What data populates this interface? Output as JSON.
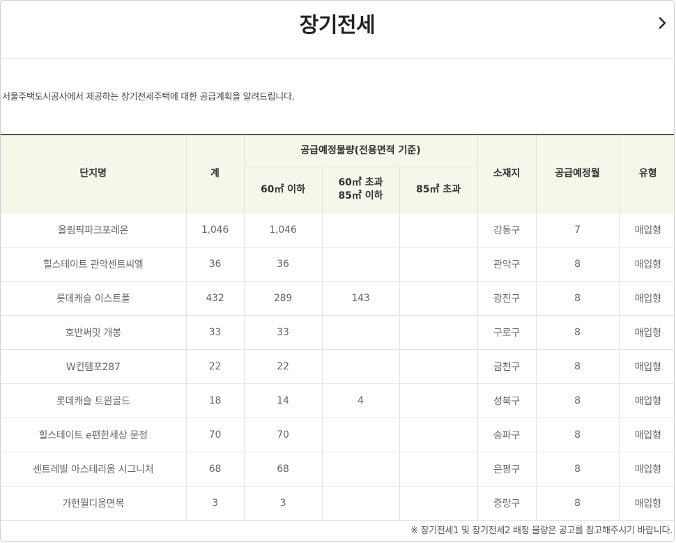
{
  "page": {
    "title": "장기전세",
    "next_icon": "chevron-right-icon",
    "intro": "서울주택도시공사에서 제공하는 장기전세주택에 대한 공급계획을 알려드립니다.",
    "footnote": "※ 장기전세1 및 장기전세2 배정 물량은 공고를 참고해주시기 바랍니다."
  },
  "colors": {
    "header_bg": "#f5f7ea",
    "table_top_border": "#555555",
    "cell_border": "#e2e2e2",
    "cell_text": "#666666"
  },
  "table": {
    "headers": {
      "name": "단지명",
      "total": "계",
      "planned_volume": "공급예정물량(전용면적 기준)",
      "size_small": "60㎡ 이하",
      "size_mid_line1": "60㎡ 초과",
      "size_mid_line2": "85㎡ 이하",
      "size_large": "85㎡ 초과",
      "location": "소재지",
      "month": "공급예정월",
      "type": "유형"
    },
    "rows": [
      {
        "name": "올림픽파크포레온",
        "total": "1,046",
        "small": "1,046",
        "mid": "",
        "large": "",
        "location": "강동구",
        "month": "7",
        "type": "매입형"
      },
      {
        "name": "힐스테이트 관악센트씨엘",
        "total": "36",
        "small": "36",
        "mid": "",
        "large": "",
        "location": "관악구",
        "month": "8",
        "type": "매입형"
      },
      {
        "name": "롯데캐슬 이스트폴",
        "total": "432",
        "small": "289",
        "mid": "143",
        "large": "",
        "location": "광진구",
        "month": "8",
        "type": "매입형"
      },
      {
        "name": "호반써밋 개봉",
        "total": "33",
        "small": "33",
        "mid": "",
        "large": "",
        "location": "구로구",
        "month": "8",
        "type": "매입형"
      },
      {
        "name": "W컨템포287",
        "total": "22",
        "small": "22",
        "mid": "",
        "large": "",
        "location": "금천구",
        "month": "8",
        "type": "매입형"
      },
      {
        "name": "롯데캐슬 트윈골드",
        "total": "18",
        "small": "14",
        "mid": "4",
        "large": "",
        "location": "성북구",
        "month": "8",
        "type": "매입형"
      },
      {
        "name": "힐스테이트 e편한세상 문정",
        "total": "70",
        "small": "70",
        "mid": "",
        "large": "",
        "location": "송파구",
        "month": "8",
        "type": "매입형"
      },
      {
        "name": "센트레빌 아스테리움 시그니처",
        "total": "68",
        "small": "68",
        "mid": "",
        "large": "",
        "location": "은평구",
        "month": "8",
        "type": "매입형"
      },
      {
        "name": "가현월디움면목",
        "total": "3",
        "small": "3",
        "mid": "",
        "large": "",
        "location": "중랑구",
        "month": "8",
        "type": "매입형"
      }
    ]
  }
}
